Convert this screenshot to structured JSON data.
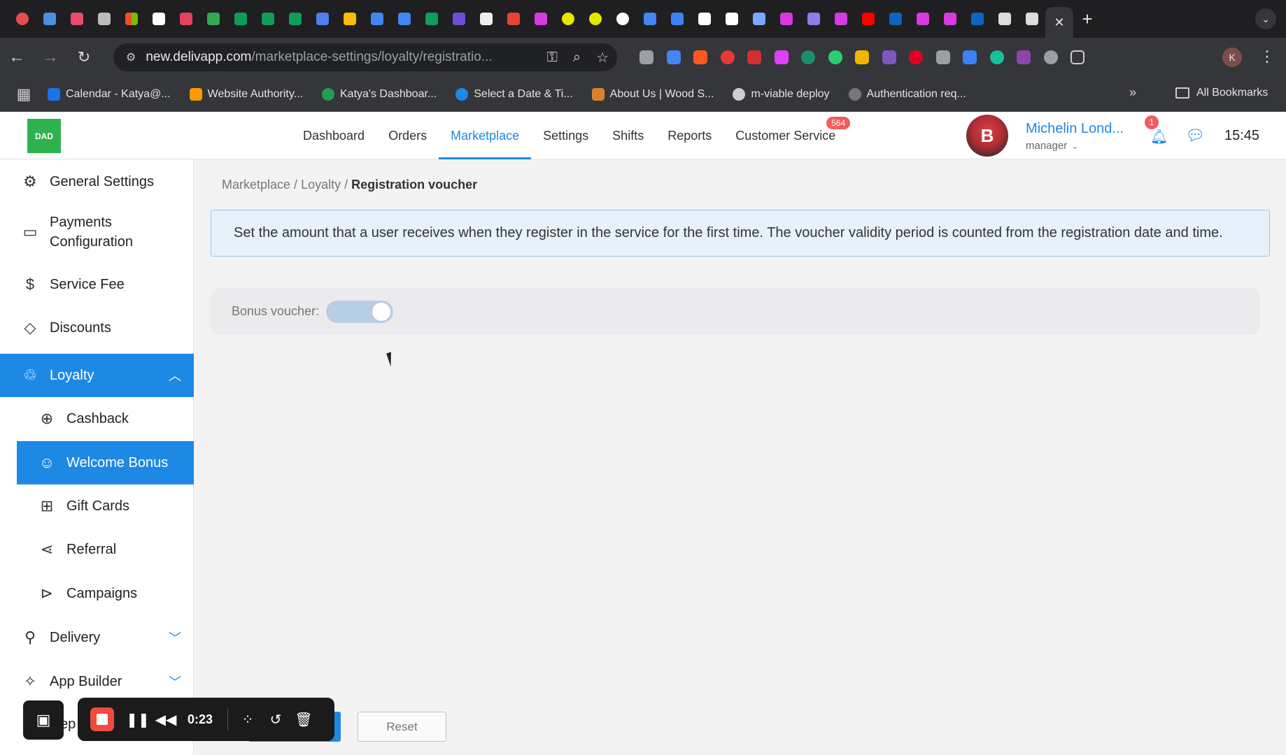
{
  "browser": {
    "url_host": "new.delivapp.com",
    "url_path": "/marketplace-settings/loyalty/registratio...",
    "active_tab_close": "✕",
    "new_tab": "+",
    "profile_initial": "K",
    "bookmarks": [
      {
        "label": "Calendar - Katya@...",
        "color": "#1a73e8"
      },
      {
        "label": "Website Authority...",
        "color": "#ff9900"
      },
      {
        "label": "Katya's Dashboar...",
        "color": "#1f9d55"
      },
      {
        "label": "Select a Date & Ti...",
        "color": "#1e88e5"
      },
      {
        "label": "About Us | Wood S...",
        "color": "#d9822b"
      },
      {
        "label": "m-viable deploy",
        "color": "#cfcfcf"
      },
      {
        "label": "Authentication req...",
        "color": "#777777"
      }
    ],
    "bookmarks_more": "»",
    "all_bookmarks": "All Bookmarks"
  },
  "app": {
    "logo_text": "DAD",
    "nav": [
      {
        "label": "Dashboard",
        "active": false
      },
      {
        "label": "Orders",
        "active": false
      },
      {
        "label": "Marketplace",
        "active": true
      },
      {
        "label": "Settings",
        "active": false
      },
      {
        "label": "Shifts",
        "active": false
      },
      {
        "label": "Reports",
        "active": false
      },
      {
        "label": "Customer Service",
        "active": false,
        "badge": "564"
      }
    ],
    "avatar_letter": "B",
    "account_name": "Michelin Lond...",
    "account_role": "manager",
    "notifications_count": "1",
    "time": "15:45"
  },
  "sidebar": {
    "items": [
      {
        "label": "General Settings",
        "icon": "gear-icon"
      },
      {
        "label": "Payments Configuration",
        "icon": "wallet-icon"
      },
      {
        "label": "Service Fee",
        "icon": "fee-icon"
      },
      {
        "label": "Discounts",
        "icon": "tag-icon"
      },
      {
        "label": "Loyalty",
        "icon": "loyalty-icon"
      },
      {
        "label": "Cashback",
        "icon": "cashback-icon"
      },
      {
        "label": "Welcome Bonus",
        "icon": "welcome-icon"
      },
      {
        "label": "Gift Cards",
        "icon": "gift-card-icon"
      },
      {
        "label": "Referral",
        "icon": "share-icon"
      },
      {
        "label": "Campaigns",
        "icon": "megaphone-icon"
      },
      {
        "label": "Delivery",
        "icon": "bike-icon"
      },
      {
        "label": "App Builder",
        "icon": "wand-icon"
      },
      {
        "label": "ep",
        "icon": "doc-icon"
      }
    ]
  },
  "main": {
    "breadcrumb": {
      "parts": [
        "Marketplace",
        "Loyalty"
      ],
      "separator": " / ",
      "current": "Registration voucher"
    },
    "info_text": "Set the amount that a user receives when they register in the service for the first time. The voucher validity period is counted from the registration date and time.",
    "bonus_label": "Bonus voucher:",
    "bonus_enabled": true,
    "reset_label": "Reset"
  },
  "recorder": {
    "time": "0:23"
  },
  "colors": {
    "accent": "#1e88e5",
    "badge": "#f25c5c",
    "logo": "#2eb24f"
  }
}
